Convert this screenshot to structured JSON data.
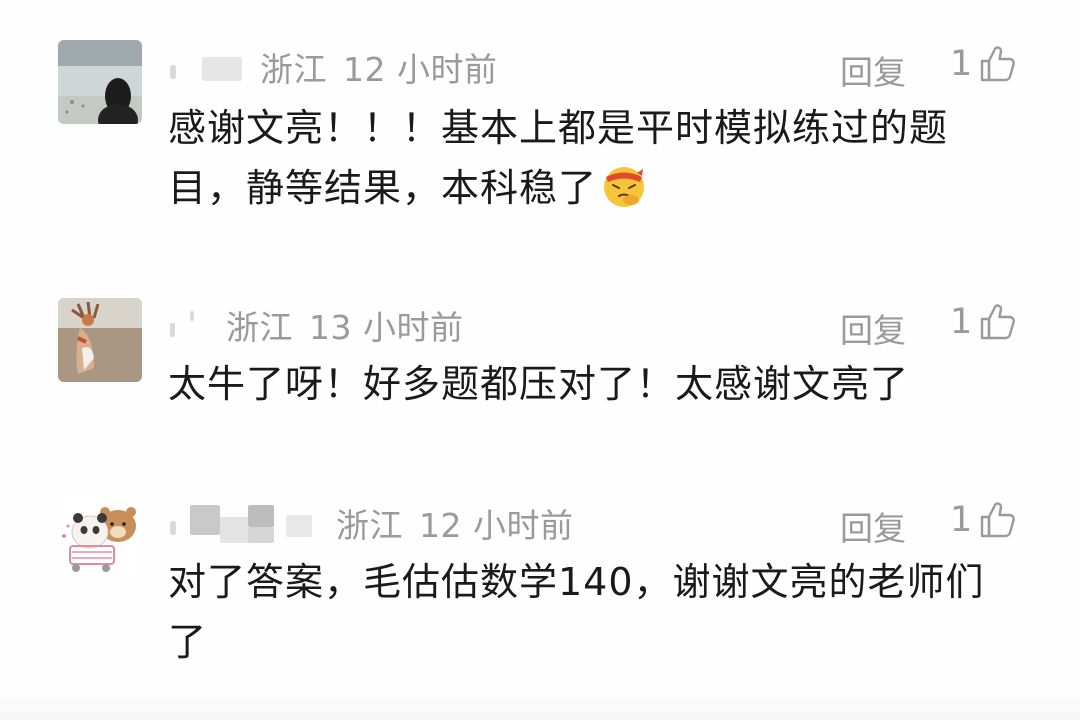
{
  "comments": [
    {
      "location": "浙江",
      "time": "12 小时前",
      "reply_label": "回复",
      "like_count": "1",
      "text": "感谢文亮！！！基本上都是平时模拟练过的题目，静等结果，本科稳了",
      "emoji": "thinking-face-emoji"
    },
    {
      "location": "浙江",
      "time": "13 小时前",
      "reply_label": "回复",
      "like_count": "1",
      "text": "太牛了呀！好多题都压对了！太感谢文亮了"
    },
    {
      "location": "浙江",
      "time": "12 小时前",
      "reply_label": "回复",
      "like_count": "1",
      "text": "对了答案，毛估估数学140，谢谢文亮的老师们了"
    }
  ],
  "icons": {
    "like": "thumbs-up-icon"
  },
  "colors": {
    "meta_text": "#9a9a9a",
    "body_text": "#1a1a1a"
  }
}
